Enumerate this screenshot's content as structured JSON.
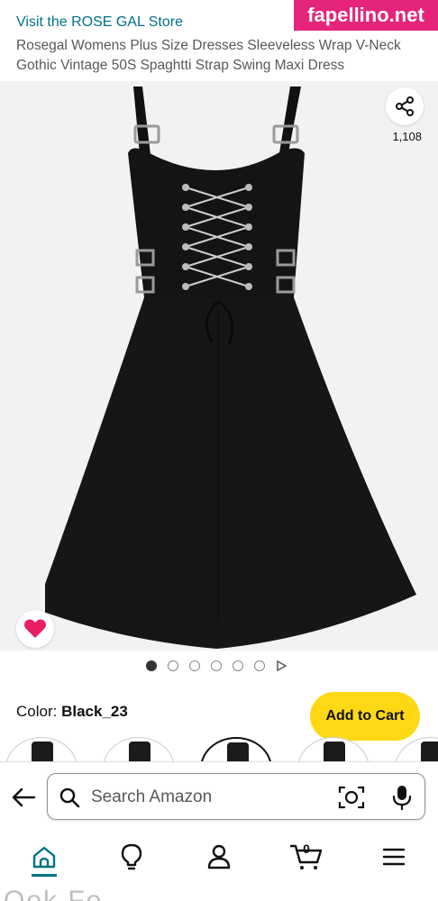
{
  "header": {
    "store_link": "Visit the ROSE GAL Store",
    "product_title": "Rosegal Womens Plus Size Dresses Sleeveless Wrap V-Neck Gothic Vintage 50S Spaghtti Strap Swing Maxi Dress",
    "watermark": "fapellino.net"
  },
  "gallery": {
    "share_icon": "share-icon",
    "share_count": "1,108",
    "wishlist_icon": "heart-icon",
    "wishlist_color": "#e91e63",
    "dot_count": 6,
    "active_dot": 1
  },
  "variant": {
    "color_label": "Color: ",
    "color_value": "Black_23",
    "add_to_cart": "Add to Cart"
  },
  "search": {
    "placeholder": "Search Amazon",
    "back_icon": "back-arrow-icon",
    "search_icon": "search-icon",
    "camera_icon": "camera-lens-icon",
    "mic_icon": "microphone-icon"
  },
  "nav": {
    "home_icon": "home-icon",
    "inspire_icon": "lightbulb-icon",
    "account_icon": "person-icon",
    "cart_icon": "cart-icon",
    "cart_count": "0",
    "menu_icon": "menu-icon",
    "accent": "#007185"
  },
  "bottom_strip": "Ook Fo..."
}
